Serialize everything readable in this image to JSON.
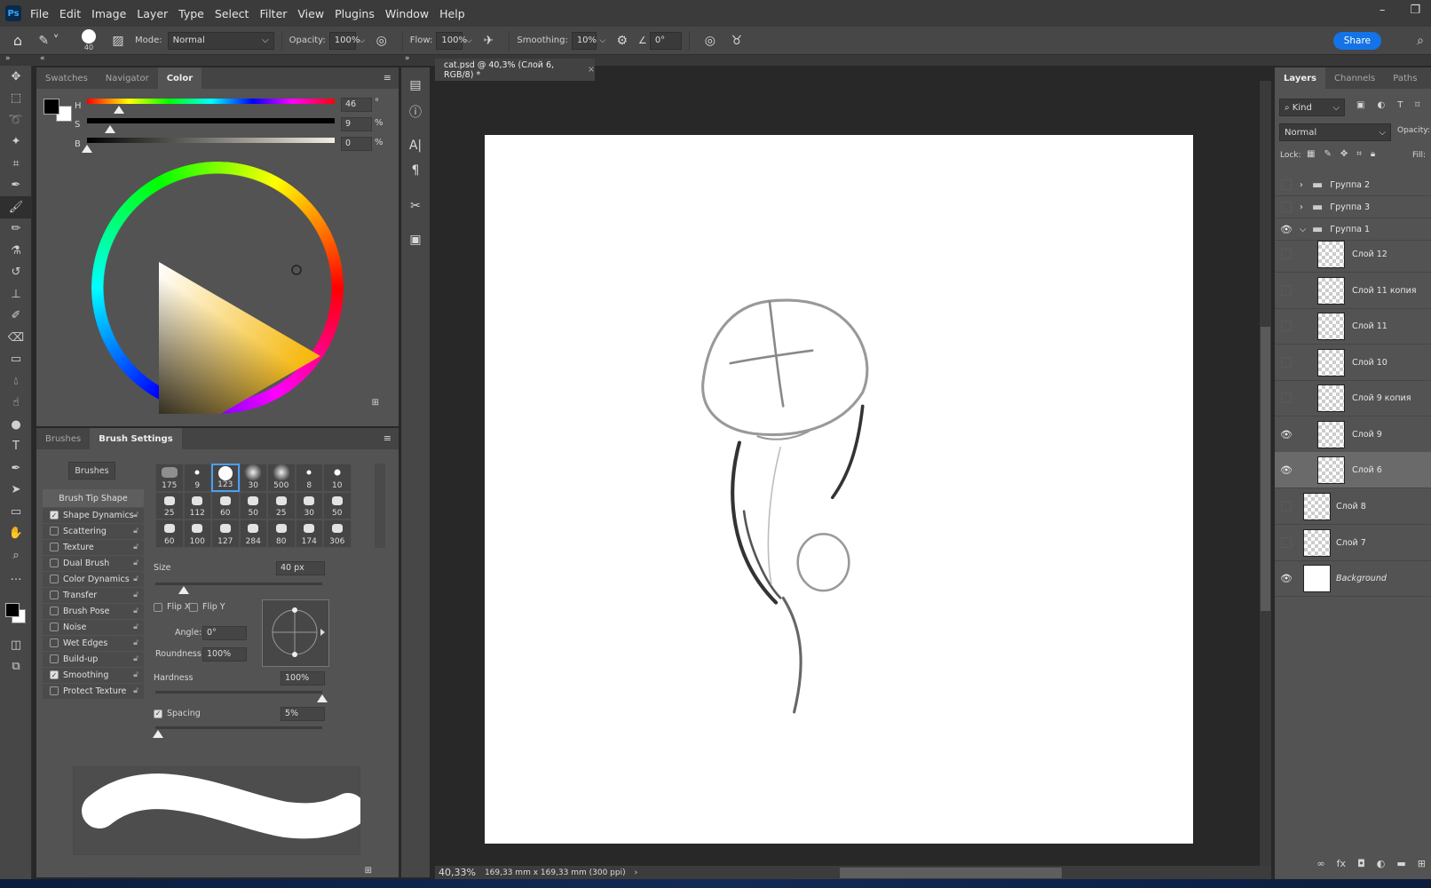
{
  "app": {
    "logo": "Ps",
    "menu": [
      "File",
      "Edit",
      "Image",
      "Layer",
      "Type",
      "Select",
      "Filter",
      "View",
      "Plugins",
      "Window",
      "Help"
    ]
  },
  "options": {
    "brush_size": "40",
    "mode_label": "Mode:",
    "mode": "Normal",
    "opacity_label": "Opacity:",
    "opacity": "100%",
    "flow_label": "Flow:",
    "flow": "100%",
    "smoothing_label": "Smoothing:",
    "smoothing": "10%",
    "angle": "0°",
    "share": "Share"
  },
  "color_panel": {
    "tabs": [
      "Swatches",
      "Navigator",
      "Color"
    ],
    "active_tab": "Color",
    "h": "46",
    "s": "9",
    "b": "0",
    "h_unit": "°",
    "s_unit": "%",
    "b_unit": "%",
    "h_label": "H",
    "s_label": "S",
    "b_label": "B",
    "foreground": "#000000",
    "background": "#ffffff"
  },
  "brush_panel": {
    "tabs": [
      "Brushes",
      "Brush Settings"
    ],
    "active_tab": "Brush Settings",
    "brushes_button": "Brushes",
    "options": [
      {
        "label": "Brush Tip Shape",
        "checked": null
      },
      {
        "label": "Shape Dynamics",
        "checked": true
      },
      {
        "label": "Scattering",
        "checked": false
      },
      {
        "label": "Texture",
        "checked": false
      },
      {
        "label": "Dual Brush",
        "checked": false
      },
      {
        "label": "Color Dynamics",
        "checked": false
      },
      {
        "label": "Transfer",
        "checked": false
      },
      {
        "label": "Brush Pose",
        "checked": false
      },
      {
        "label": "Noise",
        "checked": false
      },
      {
        "label": "Wet Edges",
        "checked": false
      },
      {
        "label": "Build-up",
        "checked": false
      },
      {
        "label": "Smoothing",
        "checked": true
      },
      {
        "label": "Protect Texture",
        "checked": false
      }
    ],
    "tips": [
      "175",
      "9",
      "123",
      "30",
      "500",
      "8",
      "10",
      "25",
      "112",
      "60",
      "50",
      "25",
      "30",
      "50",
      "60",
      "100",
      "127",
      "284",
      "80",
      "174",
      "306"
    ],
    "selected_tip": "123",
    "size_label": "Size",
    "size": "40 px",
    "flip_x": "Flip X",
    "flip_y": "Flip Y",
    "angle_label": "Angle:",
    "angle": "0°",
    "roundness_label": "Roundness:",
    "roundness": "100%",
    "hardness_label": "Hardness",
    "hardness": "100%",
    "spacing_label": "Spacing",
    "spacing": "5%",
    "spacing_checked": true
  },
  "document": {
    "tab_title": "cat.psd @ 40,3% (Слой 6, RGB/8) *",
    "zoom": "40,33%",
    "doc_info": "169,33 mm x 169,33 mm (300 ppi)"
  },
  "layers_panel": {
    "tabs": [
      "Layers",
      "Channels",
      "Paths"
    ],
    "active_tab": "Layers",
    "filter": "Kind",
    "blend": "Normal",
    "opacity_label": "Opacity:",
    "lock_label": "Lock:",
    "fill_label": "Fill:",
    "layers": [
      {
        "name": "Группа 2",
        "type": "group",
        "visible": false,
        "expanded": false
      },
      {
        "name": "Группа 3",
        "type": "group",
        "visible": false,
        "expanded": false
      },
      {
        "name": "Группа 1",
        "type": "group",
        "visible": true,
        "expanded": true
      },
      {
        "name": "Слой 12",
        "type": "layer",
        "visible": false,
        "indent": true
      },
      {
        "name": "Слой 11 копия",
        "type": "layer",
        "visible": false,
        "indent": true
      },
      {
        "name": "Слой 11",
        "type": "layer",
        "visible": false,
        "indent": true
      },
      {
        "name": "Слой 10",
        "type": "layer",
        "visible": false,
        "indent": true
      },
      {
        "name": "Слой 9 копия",
        "type": "layer",
        "visible": false,
        "indent": true
      },
      {
        "name": "Слой 9",
        "type": "layer",
        "visible": true,
        "indent": true
      },
      {
        "name": "Слой 6",
        "type": "layer",
        "visible": true,
        "indent": true,
        "selected": true
      },
      {
        "name": "Слой 8",
        "type": "layer",
        "visible": false
      },
      {
        "name": "Слой 7",
        "type": "layer",
        "visible": false
      },
      {
        "name": "Background",
        "type": "background",
        "visible": true
      }
    ]
  }
}
